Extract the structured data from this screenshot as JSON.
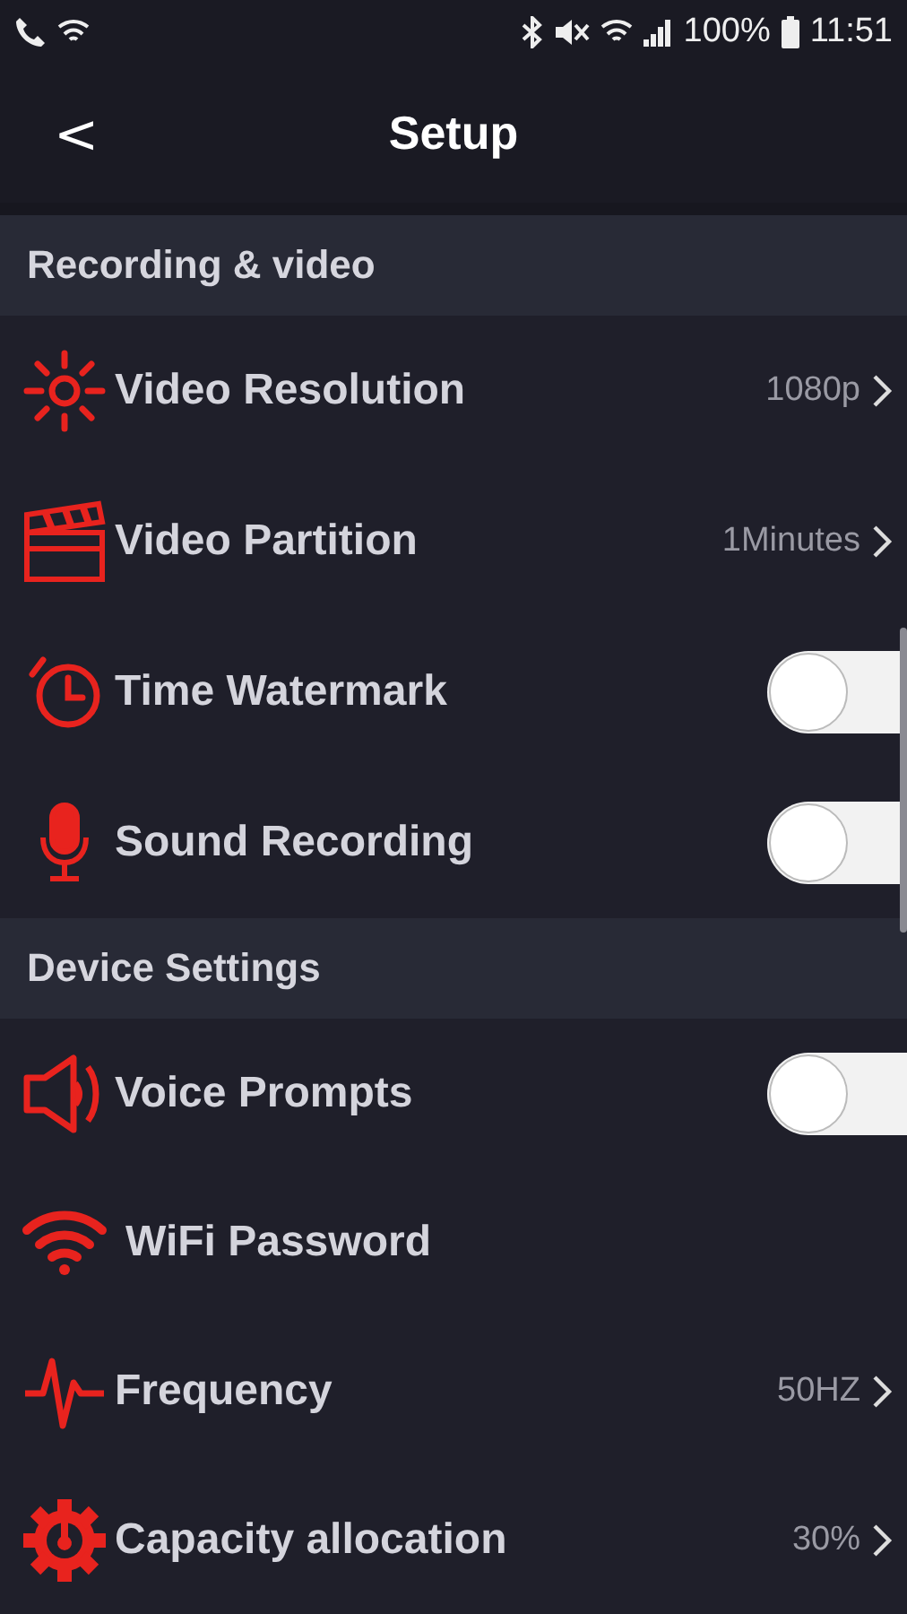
{
  "status_bar": {
    "battery": "100%",
    "time": "11:51"
  },
  "header": {
    "back": "<",
    "title": "Setup"
  },
  "sections": [
    {
      "title": "Recording & video",
      "rows": [
        {
          "kind": "value",
          "label": "Video Resolution",
          "value": "1080p"
        },
        {
          "kind": "value",
          "label": "Video Partition",
          "value": "1Minutes"
        },
        {
          "kind": "toggle",
          "label": "Time Watermark",
          "on": false
        },
        {
          "kind": "toggle",
          "label": "Sound Recording",
          "on": false
        }
      ]
    },
    {
      "title": "Device Settings",
      "rows": [
        {
          "kind": "toggle",
          "label": "Voice Prompts",
          "on": false
        },
        {
          "kind": "link",
          "label": "WiFi Password"
        },
        {
          "kind": "value",
          "label": "Frequency",
          "value": "50HZ"
        },
        {
          "kind": "value",
          "label": "Capacity allocation",
          "value": "30%"
        }
      ]
    }
  ]
}
